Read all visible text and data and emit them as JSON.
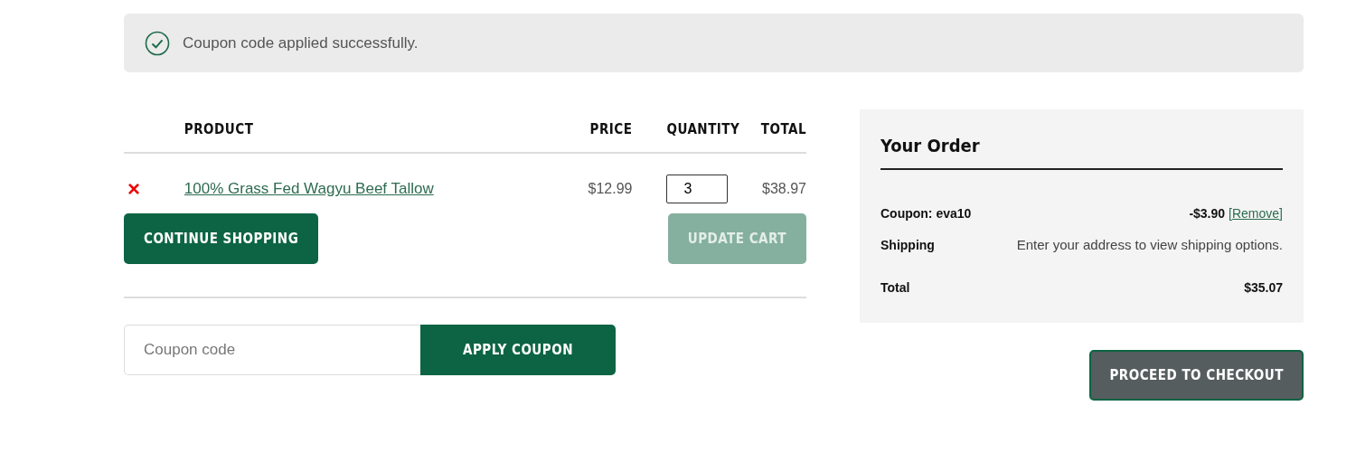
{
  "notice": {
    "text": "Coupon code applied successfully."
  },
  "cart": {
    "columns": [
      "PRODUCT",
      "PRICE",
      "QUANTITY",
      "TOTAL"
    ],
    "rows": [
      {
        "remove": "×",
        "product": "100% Grass Fed Wagyu Beef Tallow",
        "price": "$12.99",
        "quantity": "3",
        "total": "$38.97"
      }
    ],
    "continue_button": {
      "label": "CONTINUE SHOPPING",
      "disabled": false
    },
    "update_button": {
      "label": "UPDATE CART",
      "disabled": true
    },
    "coupon": {
      "placeholder": "Coupon code",
      "button": "APPLY COUPON"
    }
  },
  "order": {
    "title": "Your Order",
    "lines": [
      {
        "kind": "coupon",
        "label": "Coupon: eva10",
        "value": "-$3.90",
        "link": "[Remove]"
      },
      {
        "kind": "note",
        "label": "Shipping",
        "value": "Enter your address to view shipping options."
      },
      {
        "kind": "total",
        "label": "Total",
        "value": "$35.07"
      }
    ],
    "checkout_button": "PROCEED TO CHECKOUT"
  }
}
